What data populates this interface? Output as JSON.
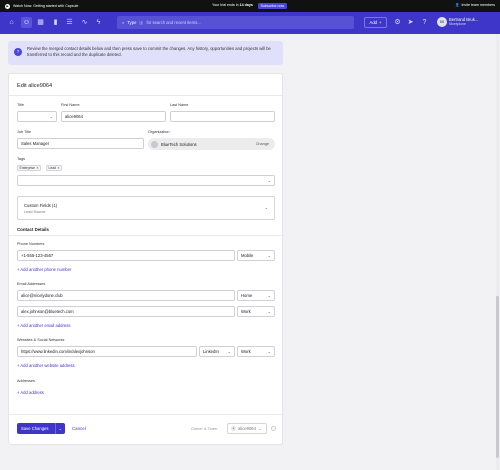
{
  "banner": {
    "watch_text": "Watch Now: Getting started with Capsule",
    "trial_text": "Your trial ends in",
    "trial_days": "14 days",
    "subscribe_label": "Subscribe now",
    "invite_label": "Invite team members"
  },
  "nav": {
    "icons": [
      "home-icon",
      "person-icon",
      "calendar-icon",
      "chart-icon",
      "list-icon",
      "trend-icon",
      "bolt-icon"
    ],
    "search_type": "Type",
    "search_slash": "/",
    "search_placeholder": "for search and recent items...",
    "add_label": "Add",
    "user_initials": "BB",
    "user_name": "Bertrand Bruk...",
    "user_sub": "Nicelydone"
  },
  "notice": {
    "text": "Review the merged contact details below and then press save to commit the changes. Any history, opportunities and projects will be transferred to this record and the duplicate deleted."
  },
  "form": {
    "title": "Edit alice9064",
    "title_label": "Title",
    "first_name_label": "First Name",
    "first_name": "alice9064",
    "last_name_label": "Last Name",
    "last_name": "",
    "job_title_label": "Job Title",
    "job_title": "Sales Manager",
    "organization_label": "Organization",
    "organization": "BlueTech Solutions",
    "change_label": "Change",
    "tags_label": "Tags",
    "tags": [
      "Enterprise",
      "Lead"
    ],
    "custom_fields_title": "Custom Fields (1)",
    "custom_fields_sub": "Lead Source",
    "contact_details_heading": "Contact Details",
    "phone_label": "Phone Numbers",
    "phone": "+1-555-123-4567",
    "phone_type": "Mobile",
    "add_phone": "+ Add another phone number",
    "email_label": "Email Addresses",
    "emails": [
      {
        "value": "alice@nicelydone.club",
        "type": "Home"
      },
      {
        "value": "alex.johnson@bluetech.com",
        "type": "Work"
      }
    ],
    "add_email": "+ Add another email address",
    "web_label": "Websites & Social Networks",
    "website": "https://www.linkedin.com/in/alexjohnson",
    "website_service": "LinkedIn",
    "website_type": "Work",
    "add_website": "+ Add another website address",
    "address_label": "Addresses",
    "add_address": "+ Add address"
  },
  "footer": {
    "save_label": "Save Changes",
    "cancel_label": "Cancel",
    "owner_label": "Owner & Team",
    "owner_value": "alice9064"
  }
}
